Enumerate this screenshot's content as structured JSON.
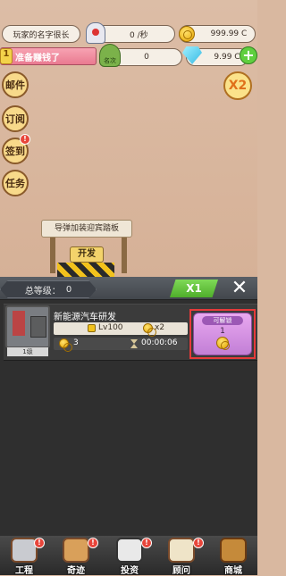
{
  "top_bar": {
    "player_name": "玩家的名字很长",
    "income_rate": "0 /秒",
    "gold": "999.99 C",
    "task_badge": "1",
    "task_text": "准备赚钱了",
    "crown_label": "名次",
    "stage_value": "0",
    "gems": "9.99 C",
    "plus_label": "+"
  },
  "side_menu": {
    "mail": "邮件",
    "subscribe": "订阅",
    "checkin": "签到",
    "tasks": "任务",
    "alert_mark": "!"
  },
  "boost": {
    "label": "X2"
  },
  "scene": {
    "sign_text": "导弹加装迎宾踏板",
    "develop_button": "开发"
  },
  "panel": {
    "total_level_label": "总等级：",
    "total_level_value": "0",
    "multiplier": "X1",
    "close_label": "✕",
    "items": [
      {
        "title": "新能源汽车研发",
        "level_tag": "1级",
        "unlock_level": "Lv100",
        "multiplier": "x2",
        "income": "3",
        "time": "00:00:06",
        "unlock_label": "可解锁",
        "unlock_count": "1"
      }
    ]
  },
  "bottom_nav": {
    "items": [
      "工程",
      "奇迹",
      "投资",
      "顾问",
      "商城"
    ]
  }
}
